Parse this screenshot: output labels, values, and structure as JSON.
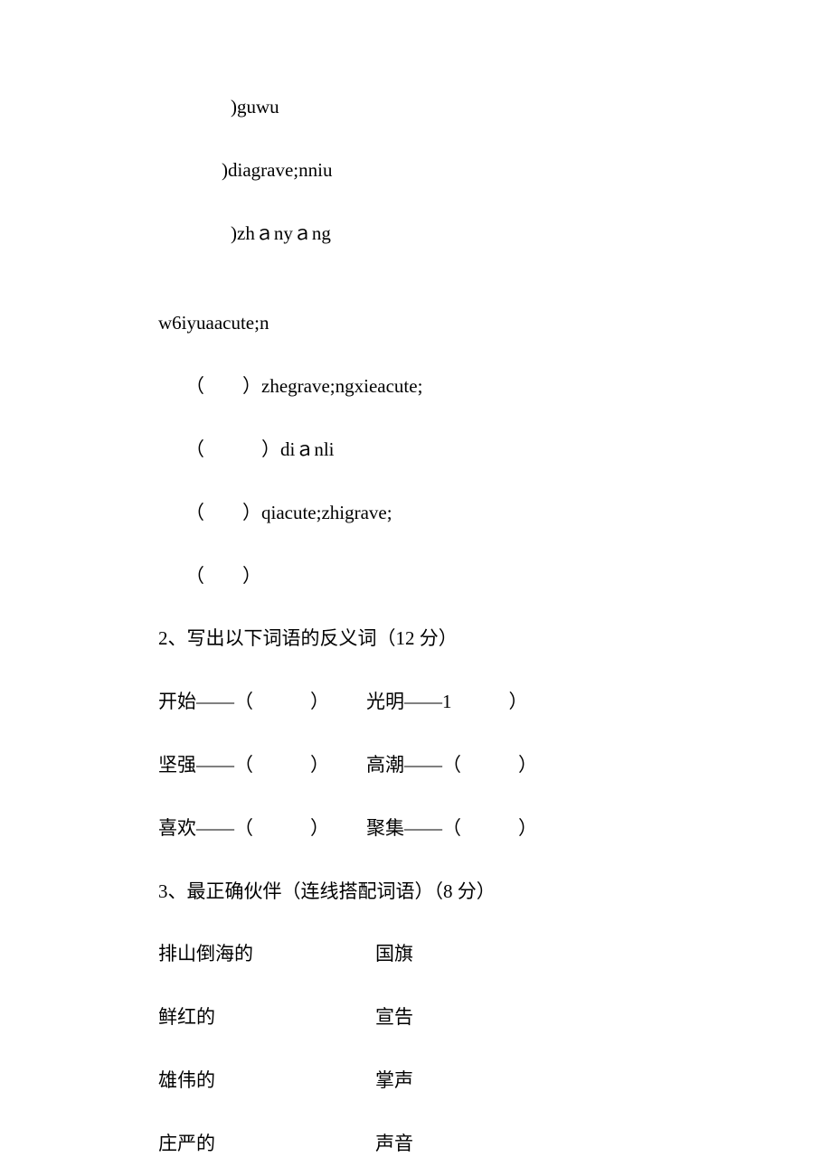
{
  "pinyin_block1": {
    "line1": ")guwu",
    "line2": ")diagrave;nniu",
    "line3": ")zhａnyａng"
  },
  "pinyin_block2": {
    "line1": "w6iyuaacute;n",
    "line2_prefix": "（　　）",
    "line2": "zhegrave;ngxieacute;",
    "line3_prefix": "（　　　）",
    "line3": "diａnli",
    "line4_prefix": "（　　）",
    "line4": "qiacute;zhigrave;",
    "line5": "（　　）"
  },
  "q2": {
    "title": "2、写出以下词语的反义词（12 分）",
    "pairs": [
      {
        "left_label": "开始——（　　　）",
        "right_label": "光明——1　　　）"
      },
      {
        "left_label": "坚强——（　　　）",
        "right_label": "高潮——（　　　）"
      },
      {
        "left_label": "喜欢——（　　　）",
        "right_label": "聚集——（　　　）"
      }
    ]
  },
  "q3": {
    "title": "3、最正确伙伴（连线搭配词语）（8 分）",
    "matches": [
      {
        "left": "排山倒海的",
        "right": "国旗"
      },
      {
        "left": "鲜红的",
        "right": "宣告"
      },
      {
        "left": "雄伟的",
        "right": "掌声"
      },
      {
        "left": "庄严的",
        "right": "声音"
      }
    ]
  }
}
